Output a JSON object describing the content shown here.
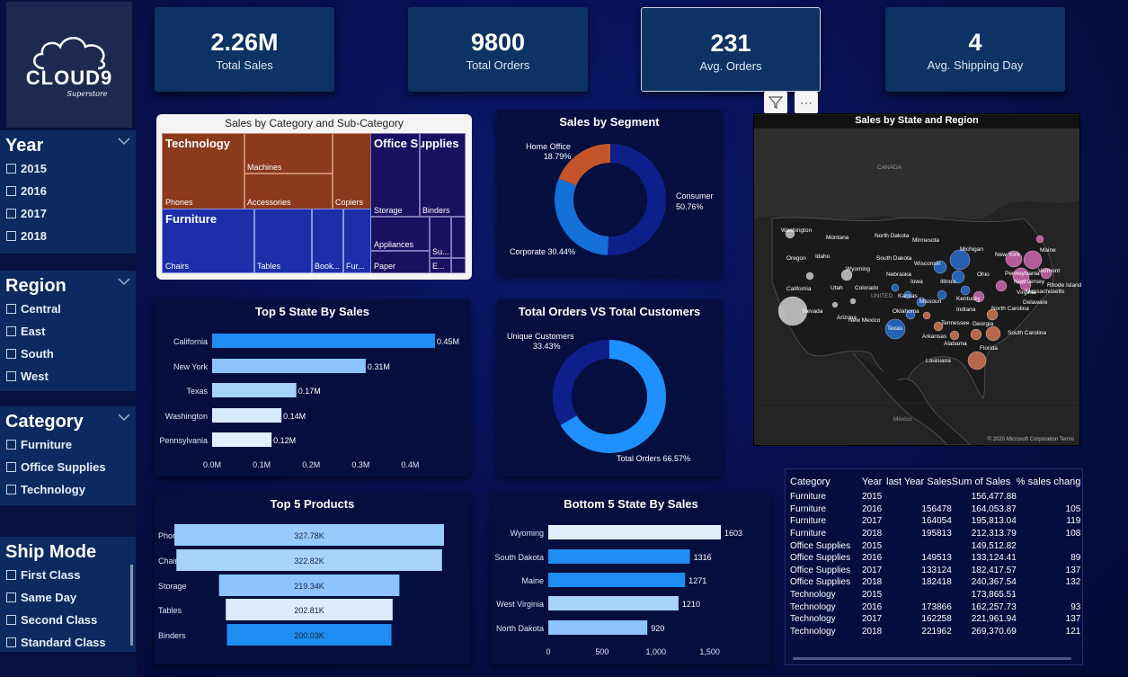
{
  "logo": {
    "brand": "CLOUD9",
    "sub": "Superstore"
  },
  "slicers": [
    {
      "title": "Year",
      "items": [
        "2015",
        "2016",
        "2017",
        "2018"
      ]
    },
    {
      "title": "Region",
      "items": [
        "Central",
        "East",
        "South",
        "West"
      ]
    },
    {
      "title": "Category",
      "items": [
        "Furniture",
        "Office Supplies",
        "Technology"
      ]
    },
    {
      "title": "Ship Mode",
      "items": [
        "First Class",
        "Same Day",
        "Second Class",
        "Standard Class"
      ]
    }
  ],
  "kpis": [
    {
      "value": "2.26M",
      "label": "Total Sales"
    },
    {
      "value": "9800",
      "label": "Total Orders"
    },
    {
      "value": "231",
      "label": "Avg. Orders"
    },
    {
      "value": "4",
      "label": "Avg. Shipping Day"
    }
  ],
  "treemap": {
    "title": "Sales by Category and Sub-Category",
    "groups": [
      "Technology",
      "Office Supplies",
      "Furniture"
    ],
    "cells": [
      "Phones",
      "Machines",
      "Accessories",
      "Copiers",
      "Storage",
      "Binders",
      "Appliances",
      "Paper",
      "Su...",
      "E...",
      "Chairs",
      "Tables",
      "Book...",
      "Fur..."
    ],
    "colors": {
      "Technology": "#8b3a1c",
      "Office Supplies": "#1a1060",
      "Furniture": "#1c2fa8"
    }
  },
  "segment": {
    "title": "Sales by Segment",
    "labels": [
      "Home Office",
      "Consumer",
      "Corporate"
    ]
  },
  "orders_customers": {
    "title": "Total Orders VS Total Customers",
    "labels": [
      "Unique Customers",
      "Total Orders"
    ]
  },
  "map": {
    "title": "Sales by State and Region",
    "places": [
      "CANADA",
      "Washington",
      "Oregon",
      "California",
      "Nevada",
      "Idaho",
      "Montana",
      "Wyoming",
      "Utah",
      "Colorado",
      "Arizona",
      "New Mexico",
      "North Dakota",
      "South Dakota",
      "Nebraska",
      "Kansas",
      "Minnesota",
      "Iowa",
      "Missouri",
      "Oklahoma",
      "Texas",
      "Wisconsin",
      "Illinois",
      "Michigan",
      "Indiana",
      "Ohio",
      "Kentucky",
      "Tennessee",
      "Arkansas",
      "Louisiana",
      "Alabama",
      "Georgia",
      "Florida",
      "North Carolina",
      "South Carolina",
      "Virginia",
      "Pennsylvania",
      "New York",
      "New Jersey",
      "Massachusetts",
      "Rhode Island",
      "Delaware",
      "Maine",
      "Vermont",
      "UNITED",
      "México"
    ],
    "footer": "© 2020 Microsoft Corporation  Terms"
  },
  "table": {
    "headers": [
      "Category",
      "Year",
      "last Year Sales",
      "Sum of Sales",
      "% sales chang"
    ],
    "rows": [
      [
        "Furniture",
        "2015",
        "",
        "156,477.88",
        ""
      ],
      [
        "Furniture",
        "2016",
        "156478",
        "164,053.87",
        "105"
      ],
      [
        "Furniture",
        "2017",
        "164054",
        "195,813.04",
        "119"
      ],
      [
        "Furniture",
        "2018",
        "195813",
        "212,313.79",
        "108"
      ],
      [
        "Office Supplies",
        "2015",
        "",
        "149,512.82",
        ""
      ],
      [
        "Office Supplies",
        "2016",
        "149513",
        "133,124.41",
        "89"
      ],
      [
        "Office Supplies",
        "2017",
        "133124",
        "182,417.57",
        "137"
      ],
      [
        "Office Supplies",
        "2018",
        "182418",
        "240,367.54",
        "132"
      ],
      [
        "Technology",
        "2015",
        "",
        "173,865.51",
        ""
      ],
      [
        "Technology",
        "2016",
        "173866",
        "162,257.73",
        "93"
      ],
      [
        "Technology",
        "2017",
        "162258",
        "221,961.94",
        "137"
      ],
      [
        "Technology",
        "2018",
        "221962",
        "269,370.69",
        "121"
      ]
    ]
  },
  "chart_data": [
    {
      "type": "pie",
      "title": "Sales by Segment",
      "categories": [
        "Consumer",
        "Corporate",
        "Home Office"
      ],
      "values": [
        50.76,
        30.44,
        18.79
      ],
      "data_labels": [
        "Consumer 50.76%",
        "Corporate 30.44%",
        "Home Office 18.79%"
      ],
      "colors": [
        "#0d1f8a",
        "#1570d8",
        "#c4552a"
      ]
    },
    {
      "type": "bar",
      "title": "Top 5 State By Sales",
      "categories": [
        "California",
        "New York",
        "Texas",
        "Washington",
        "Pennsylvania"
      ],
      "values": [
        0.45,
        0.31,
        0.17,
        0.14,
        0.12
      ],
      "data_labels": [
        "0.45M",
        "0.31M",
        "0.17M",
        "0.14M",
        "0.12M"
      ],
      "xticks": [
        "0.0M",
        "0.1M",
        "0.2M",
        "0.3M",
        "0.4M"
      ],
      "xlim": [
        0,
        0.45
      ],
      "colors": [
        "#1e8cf0",
        "#8cc4fb",
        "#a7d2fc",
        "#d6eafe",
        "#e1f0fe"
      ]
    },
    {
      "type": "pie",
      "title": "Total Orders VS Total Customers",
      "categories": [
        "Total Orders",
        "Unique Customers"
      ],
      "values": [
        66.57,
        33.43
      ],
      "data_labels": [
        "Total Orders 66.57%",
        "Unique Customers 33.43%"
      ],
      "colors": [
        "#1e90ff",
        "#0e1f8c"
      ]
    },
    {
      "type": "bar",
      "title": "Top 5 Products",
      "categories": [
        "Phones",
        "Chairs",
        "Storage",
        "Tables",
        "Binders"
      ],
      "values": [
        327.78,
        322.82,
        219.34,
        202.81,
        200.03
      ],
      "data_labels": [
        "327.78K",
        "322.82K",
        "219.34K",
        "202.81K",
        "200.03K"
      ],
      "colors": [
        "#97cbfb",
        "#a8d4fc",
        "#8cc4fb",
        "#dbecfe",
        "#1e8cf0"
      ]
    },
    {
      "type": "bar",
      "title": "Bottom 5 State By Sales",
      "categories": [
        "Wyoming",
        "South Dakota",
        "Maine",
        "West Virginia",
        "North Dakota"
      ],
      "values": [
        1603,
        1316,
        1271,
        1210,
        920
      ],
      "data_labels": [
        "1603",
        "1316",
        "1271",
        "1210",
        "920"
      ],
      "xticks": [
        "0",
        "500",
        "1,000",
        "1,500"
      ],
      "xlim": [
        0,
        1603
      ],
      "colors": [
        "#e1f0fe",
        "#1e8cf0",
        "#1e8cf0",
        "#a7d2fc",
        "#8cc4fb"
      ]
    }
  ]
}
